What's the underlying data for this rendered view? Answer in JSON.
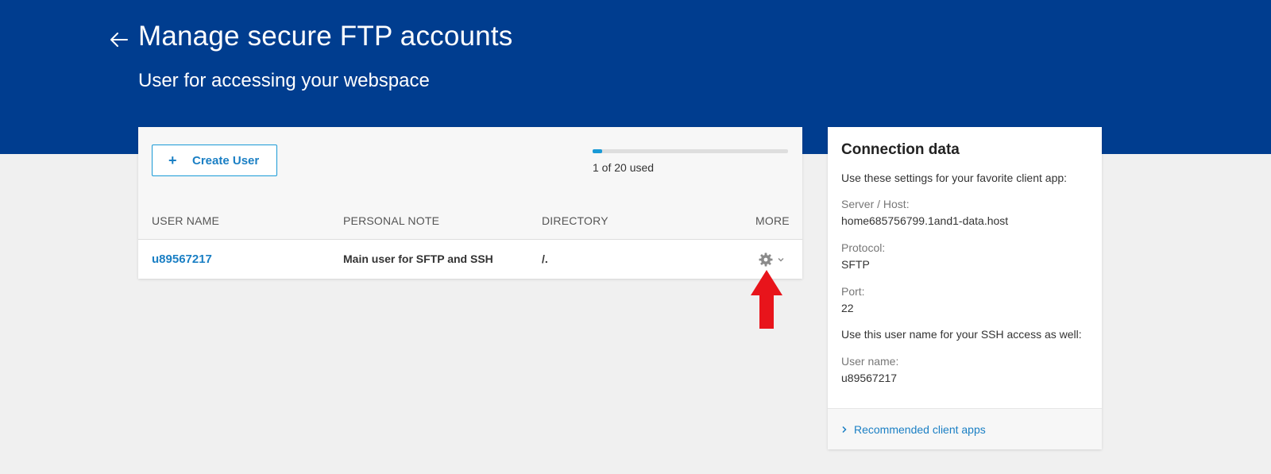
{
  "header": {
    "title": "Manage secure FTP accounts",
    "subtitle": "User for accessing your webspace",
    "back_icon": "arrow-left-icon",
    "background_color": "#003d8f"
  },
  "toolbar": {
    "create_user_label": "Create User",
    "create_user_icon": "plus-icon"
  },
  "usage": {
    "used": 1,
    "total": 20,
    "label": "1 of 20 used",
    "fill_fraction": 0.05
  },
  "table": {
    "columns": [
      "USER NAME",
      "PERSONAL NOTE",
      "DIRECTORY",
      "MORE"
    ],
    "rows": [
      {
        "user_name": "u89567217",
        "personal_note": "Main user for SFTP and SSH",
        "directory": "/.",
        "more_icon": "gear-icon"
      }
    ]
  },
  "connection_data": {
    "title": "Connection data",
    "intro": "Use these settings for your favorite client app:",
    "server_label": "Server / Host:",
    "server_value": "home685756799.1and1-data.host",
    "protocol_label": "Protocol:",
    "protocol_value": "SFTP",
    "port_label": "Port:",
    "port_value": "22",
    "ssh_note": "Use this user name for your SSH access as well:",
    "username_label": "User name:",
    "username_value": "u89567217",
    "recommended_link": "Recommended client apps"
  },
  "colors": {
    "accent": "#1a7fc4",
    "annotation_arrow": "#e8141b"
  }
}
